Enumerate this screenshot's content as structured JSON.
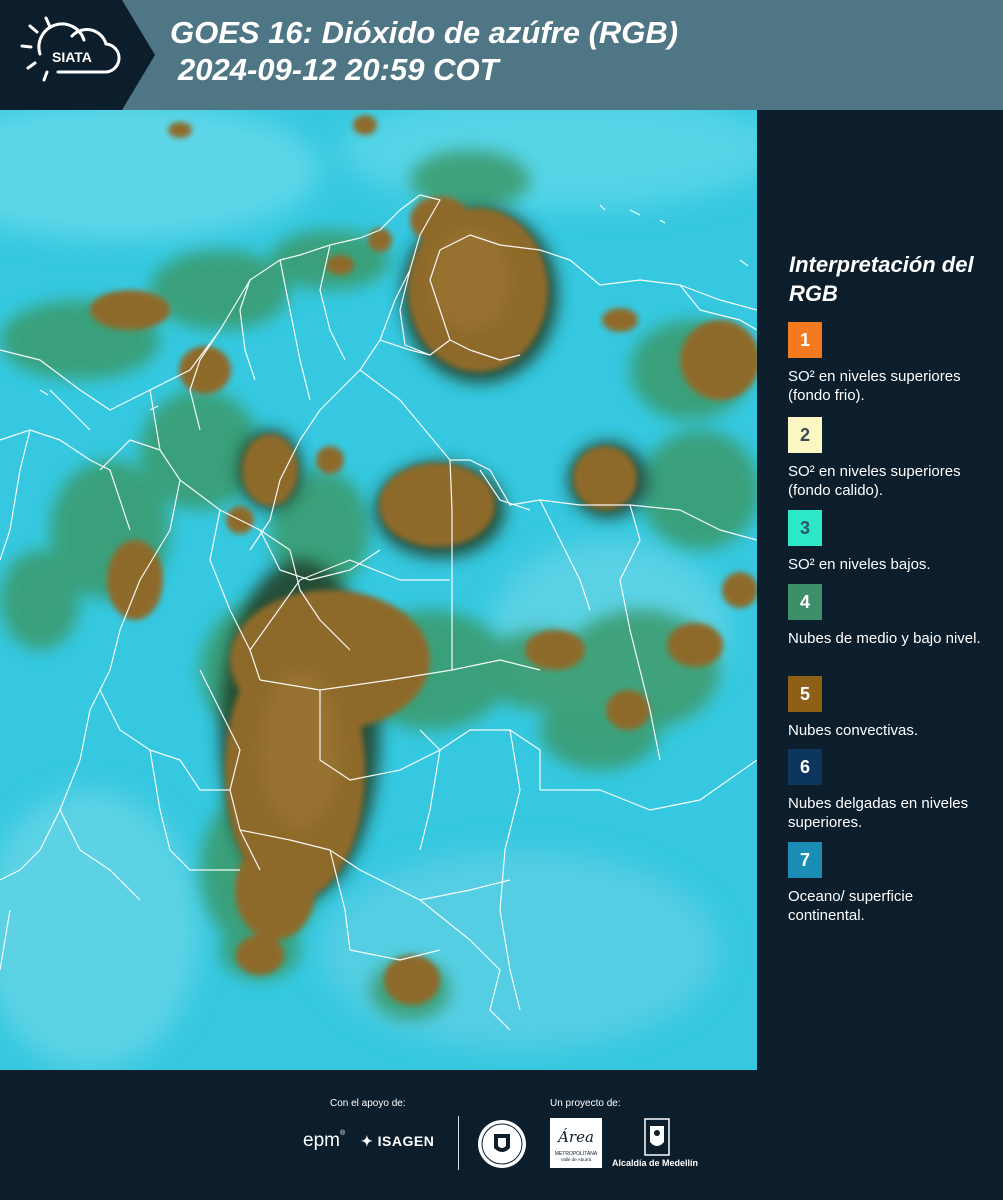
{
  "header": {
    "logo_text": "SIATA",
    "title_line1": "GOES 16: Dióxido de azúfre (RGB)",
    "title_line2": "2024-09-12 20:59 COT"
  },
  "legend": {
    "title": "Interpretación del RGB",
    "items": [
      {
        "number": "1",
        "color": "#f47a1f",
        "num_color": "#ffffff",
        "text": "SO² en niveles superiores (fondo frio)."
      },
      {
        "number": "2",
        "color": "#fdf7c4",
        "num_color": "#3a4a55",
        "text": "SO² en niveles superiores (fondo calido)."
      },
      {
        "number": "3",
        "color": "#2ce8c8",
        "num_color": "#2a5a60",
        "text": "SO² en niveles bajos."
      },
      {
        "number": "4",
        "color": "#3d8f6a",
        "num_color": "#ffffff",
        "text": "Nubes de medio y bajo nivel."
      },
      {
        "number": "5",
        "color": "#8e5f16",
        "num_color": "#ffffff",
        "text": "Nubes convectivas."
      },
      {
        "number": "6",
        "color": "#0c3560",
        "num_color": "#ffffff",
        "text": "Nubes delgadas en niveles superiores."
      },
      {
        "number": "7",
        "color": "#1a8db4",
        "num_color": "#ffffff",
        "text": "Oceano/ superficie continental."
      }
    ]
  },
  "footer": {
    "support_label": "Con el apoyo de:",
    "project_label": "Un proyecto de:",
    "epm": "epm",
    "isagen": "ISAGEN",
    "area_script": "Área",
    "area_line1": "METROPOLITANA",
    "area_line2": "Valle de Aburrá",
    "alcaldia": "Alcaldía de Medellín"
  },
  "colors": {
    "header_bg": "#4e7684",
    "panel_bg": "#0c1d2b",
    "sea": "#35c8e0",
    "cloud_convective": "#8e6a2c",
    "cloud_low": "#3a9a6a",
    "border_line": "#ffffff"
  }
}
